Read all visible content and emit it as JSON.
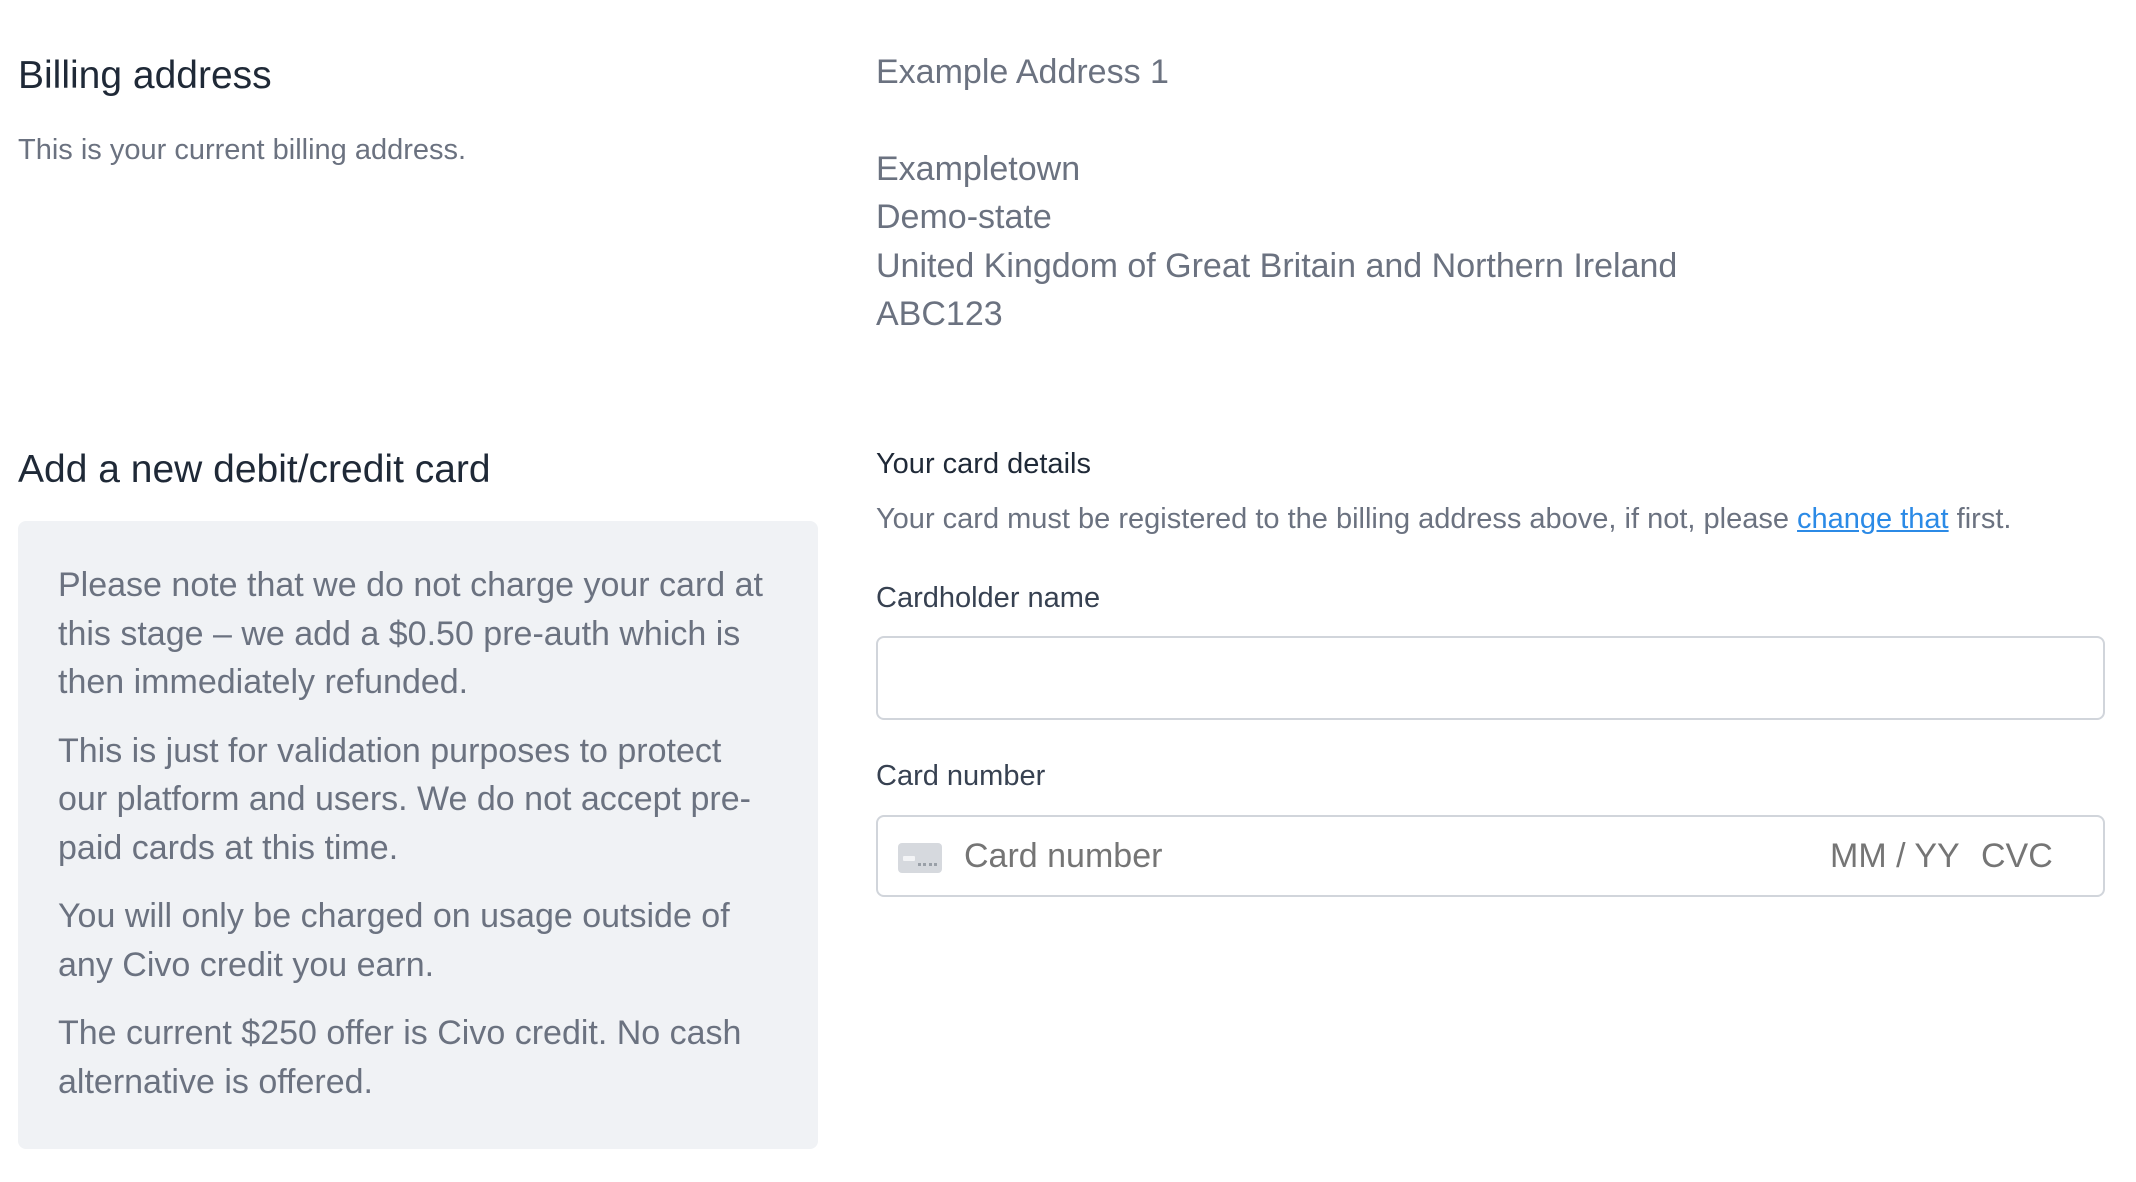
{
  "billing": {
    "title": "Billing address",
    "subtitle": "This is your current billing address.",
    "address": {
      "line1": "Example Address 1",
      "city": "Exampletown",
      "state": "Demo-state",
      "country": "United Kingdom of Great Britain and Northern Ireland",
      "postcode": "ABC123"
    }
  },
  "new_card": {
    "title": "Add a new debit/credit card",
    "notes": [
      "Please note that we do not charge your card at this stage – we add a $0.50 pre-auth which is then immediately refunded.",
      "This is just for validation purposes to protect our platform and users. We do not accept pre-paid cards at this time.",
      "You will only be charged on usage outside of any Civo credit you earn.",
      "The current $250 offer is Civo credit. No cash alternative is offered."
    ]
  },
  "form": {
    "heading": "Your card details",
    "note_prefix": "Your card must be registered to the billing address above, if not, please ",
    "note_link": "change that",
    "note_suffix": " first.",
    "cardholder_label": "Cardholder name",
    "cardholder_value": "",
    "card_number_label": "Card number",
    "card_number_placeholder": "Card number",
    "expiry_placeholder": "MM / YY",
    "cvc_placeholder": "CVC",
    "card_icon": "credit-card-icon",
    "link_color": "#2b8ae6"
  }
}
